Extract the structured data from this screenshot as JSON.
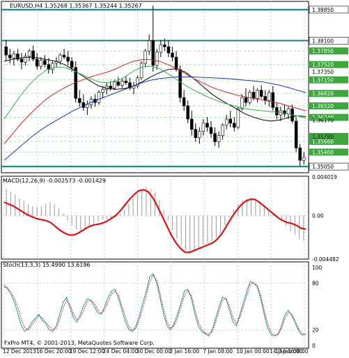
{
  "chart_data": [
    {
      "type": "candlestick",
      "panel": "price",
      "title": "EURUSD,H4  1.35268 1.35367 1.35244 1.35267",
      "y_ticks": [
        "1.38850",
        "1.38100",
        "1.37350",
        "1.36170",
        "1.35780",
        "1.35050"
      ],
      "price_level_labels": [
        "1.38850",
        "1.38100",
        "1.37850",
        "1.37520",
        "1.37150",
        "1.36820",
        "1.36520",
        "1.36240",
        "1.35780",
        "1.35660",
        "1.35400",
        "1.35050"
      ],
      "horizontal_levels": [
        1.3885,
        1.381,
        1.3505
      ],
      "ylim": [
        1.349,
        1.3905
      ],
      "current_price": "1.35050",
      "ohlc": [
        [
          1.3795,
          1.3812,
          1.376,
          1.3775
        ],
        [
          1.3775,
          1.379,
          1.3755,
          1.3768
        ],
        [
          1.3768,
          1.3785,
          1.375,
          1.3778
        ],
        [
          1.3778,
          1.379,
          1.376,
          1.3765
        ],
        [
          1.3765,
          1.378,
          1.374,
          1.3758
        ],
        [
          1.3758,
          1.378,
          1.375,
          1.3772
        ],
        [
          1.3772,
          1.379,
          1.376,
          1.3785
        ],
        [
          1.3785,
          1.3798,
          1.376,
          1.3765
        ],
        [
          1.3765,
          1.378,
          1.374,
          1.3748
        ],
        [
          1.3748,
          1.377,
          1.374,
          1.3762
        ],
        [
          1.3762,
          1.3775,
          1.3745,
          1.3752
        ],
        [
          1.3752,
          1.3768,
          1.373,
          1.374
        ],
        [
          1.374,
          1.376,
          1.373,
          1.3755
        ],
        [
          1.3755,
          1.377,
          1.3745,
          1.376
        ],
        [
          1.376,
          1.378,
          1.3752,
          1.3775
        ],
        [
          1.3775,
          1.379,
          1.3765,
          1.377
        ],
        [
          1.377,
          1.3785,
          1.375,
          1.376
        ],
        [
          1.376,
          1.377,
          1.3735,
          1.3745
        ],
        [
          1.3745,
          1.376,
          1.366,
          1.367
        ],
        [
          1.367,
          1.369,
          1.365,
          1.366
        ],
        [
          1.366,
          1.368,
          1.364,
          1.3648
        ],
        [
          1.3648,
          1.3665,
          1.363,
          1.3655
        ],
        [
          1.3655,
          1.3675,
          1.3645,
          1.3668
        ],
        [
          1.3668,
          1.368,
          1.365,
          1.366
        ],
        [
          1.366,
          1.369,
          1.3655,
          1.3685
        ],
        [
          1.3685,
          1.37,
          1.367,
          1.3692
        ],
        [
          1.3692,
          1.3708,
          1.368,
          1.37
        ],
        [
          1.37,
          1.3712,
          1.3688,
          1.3695
        ],
        [
          1.3695,
          1.3715,
          1.369,
          1.371
        ],
        [
          1.371,
          1.3722,
          1.3698,
          1.3702
        ],
        [
          1.3702,
          1.3718,
          1.3695,
          1.3712
        ],
        [
          1.3712,
          1.3725,
          1.3702,
          1.3708
        ],
        [
          1.3708,
          1.372,
          1.369,
          1.3695
        ],
        [
          1.3695,
          1.371,
          1.368,
          1.37
        ],
        [
          1.37,
          1.3725,
          1.3695,
          1.372
        ],
        [
          1.372,
          1.376,
          1.3715,
          1.3755
        ],
        [
          1.3755,
          1.379,
          1.3745,
          1.3785
        ],
        [
          1.3785,
          1.3825,
          1.3775,
          1.381
        ],
        [
          1.381,
          1.3895,
          1.3735,
          1.375
        ],
        [
          1.375,
          1.379,
          1.374,
          1.3782
        ],
        [
          1.3782,
          1.3812,
          1.377,
          1.38
        ],
        [
          1.38,
          1.3815,
          1.3785,
          1.3795
        ],
        [
          1.3795,
          1.381,
          1.377,
          1.378
        ],
        [
          1.378,
          1.3795,
          1.376,
          1.377
        ],
        [
          1.377,
          1.3785,
          1.3735,
          1.374
        ],
        [
          1.374,
          1.375,
          1.366,
          1.3672
        ],
        [
          1.3672,
          1.369,
          1.364,
          1.3652
        ],
        [
          1.3652,
          1.3665,
          1.361,
          1.362
        ],
        [
          1.362,
          1.364,
          1.358,
          1.3595
        ],
        [
          1.3595,
          1.361,
          1.3565,
          1.3575
        ],
        [
          1.3575,
          1.36,
          1.356,
          1.359
        ],
        [
          1.359,
          1.362,
          1.358,
          1.361
        ],
        [
          1.361,
          1.3625,
          1.359,
          1.36
        ],
        [
          1.36,
          1.3615,
          1.3575,
          1.3585
        ],
        [
          1.3585,
          1.36,
          1.3555,
          1.3565
        ],
        [
          1.3565,
          1.359,
          1.355,
          1.358
        ],
        [
          1.358,
          1.361,
          1.357,
          1.3605
        ],
        [
          1.3605,
          1.363,
          1.3595,
          1.362
        ],
        [
          1.362,
          1.364,
          1.36,
          1.361
        ],
        [
          1.361,
          1.3625,
          1.359,
          1.36
        ],
        [
          1.36,
          1.365,
          1.3595,
          1.3645
        ],
        [
          1.3645,
          1.368,
          1.364,
          1.3672
        ],
        [
          1.3672,
          1.3695,
          1.365,
          1.366
        ],
        [
          1.366,
          1.369,
          1.3655,
          1.3685
        ],
        [
          1.3685,
          1.37,
          1.3665,
          1.367
        ],
        [
          1.367,
          1.3695,
          1.366,
          1.369
        ],
        [
          1.369,
          1.3702,
          1.367,
          1.3675
        ],
        [
          1.3675,
          1.369,
          1.3655,
          1.3665
        ],
        [
          1.3665,
          1.369,
          1.365,
          1.3684
        ],
        [
          1.3684,
          1.37,
          1.364,
          1.3648
        ],
        [
          1.3648,
          1.366,
          1.362,
          1.363
        ],
        [
          1.363,
          1.365,
          1.3615,
          1.364
        ],
        [
          1.364,
          1.3655,
          1.3625,
          1.3632
        ],
        [
          1.3632,
          1.365,
          1.362,
          1.3645
        ],
        [
          1.3645,
          1.3655,
          1.361,
          1.3615
        ],
        [
          1.3615,
          1.3625,
          1.354,
          1.355
        ],
        [
          1.355,
          1.356,
          1.3505,
          1.352
        ],
        [
          1.352,
          1.354,
          1.351,
          1.3527
        ]
      ],
      "moving_averages": [
        {
          "color": "#000000",
          "values": [
            1.376,
            1.3765,
            1.3768,
            1.377,
            1.3768,
            1.3764,
            1.376,
            1.3752,
            1.374,
            1.3726,
            1.3712,
            1.37,
            1.3694,
            1.3692,
            1.3694,
            1.37,
            1.371,
            1.3722,
            1.3732,
            1.374,
            1.3742,
            1.3734,
            1.3718,
            1.37,
            1.3682,
            1.3668,
            1.3656,
            1.3644,
            1.3632,
            1.3624,
            1.3618,
            1.3615,
            1.3618,
            1.3624,
            1.3628,
            1.3626
          ]
        },
        {
          "color": "#2db34a",
          "values": [
            1.362,
            1.365,
            1.368,
            1.3705,
            1.3725,
            1.374,
            1.3746,
            1.3745,
            1.3738,
            1.3728,
            1.3718,
            1.371,
            1.3708,
            1.3712,
            1.3722,
            1.3736,
            1.3746,
            1.3748,
            1.3742,
            1.373,
            1.3716,
            1.3702,
            1.369,
            1.368,
            1.367,
            1.3662,
            1.3656,
            1.365,
            1.3645,
            1.3642,
            1.364,
            1.3638,
            1.3636,
            1.3632,
            1.3628,
            1.3622
          ]
        },
        {
          "color": "#d62020",
          "values": [
            1.356,
            1.3585,
            1.361,
            1.3632,
            1.3652,
            1.367,
            1.3684,
            1.3696,
            1.3706,
            1.3714,
            1.3722,
            1.3728,
            1.3734,
            1.3742,
            1.3752,
            1.376,
            1.3764,
            1.3764,
            1.376,
            1.3752,
            1.3742,
            1.373,
            1.3718,
            1.3708,
            1.3698,
            1.369,
            1.3684,
            1.3678,
            1.3674,
            1.367,
            1.3666,
            1.3662,
            1.3658,
            1.3652,
            1.3646,
            1.364
          ]
        },
        {
          "color": "#1a33c4",
          "values": [
            1.352,
            1.3538,
            1.3556,
            1.3574,
            1.359,
            1.3604,
            1.3616,
            1.3628,
            1.364,
            1.365,
            1.366,
            1.3668,
            1.3676,
            1.3684,
            1.3692,
            1.37,
            1.3708,
            1.3714,
            1.3718,
            1.372,
            1.3722,
            1.3722,
            1.3722,
            1.3721,
            1.372,
            1.3719,
            1.3718,
            1.3716,
            1.3714,
            1.3712,
            1.371,
            1.3706,
            1.3702,
            1.3696,
            1.369,
            1.3684
          ]
        }
      ],
      "x_ticks": [
        "12 Dec 2013",
        "16 Dec 20:00",
        "19 Dec 12:00",
        "24 Dec 04:00",
        "30 Dec 00:00",
        "2 Jan 16:00",
        "7 Jan 08:00",
        "10 Jan 00:00",
        "14 Jan 16:00",
        "17 Jan 08:00"
      ]
    },
    {
      "type": "histogram+line",
      "panel": "macd",
      "title": "MACD(12,26,9) -0.002573 -0.001429",
      "y_ticks": [
        "0.004019",
        "0.00",
        "-0.004482"
      ],
      "ylim": [
        -0.0045,
        0.0041
      ],
      "histogram": [
        0.0028,
        0.0025,
        0.0022,
        0.0018,
        0.0016,
        0.0012,
        0.001,
        0.0009,
        0.001,
        0.0012,
        0.0014,
        0.0012,
        0.0008,
        0.0002,
        -0.0005,
        -0.001,
        -0.0014,
        -0.0016,
        -0.0015,
        -0.0012,
        -0.0009,
        -0.0006,
        -0.0004,
        -0.0003,
        -0.0002,
        -0.0001,
        0.0002,
        0.0006,
        0.0012,
        0.0018,
        0.0023,
        0.0027,
        0.003,
        0.0028,
        0.0024,
        0.0016,
        0.0006,
        -0.0005,
        -0.0015,
        -0.0024,
        -0.0031,
        -0.0036,
        -0.0038,
        -0.0036,
        -0.0033,
        -0.003,
        -0.0028,
        -0.0026,
        -0.0023,
        -0.0018,
        -0.001,
        -0.0002,
        0.0006,
        0.0012,
        0.0016,
        0.0018,
        0.0019,
        0.0018,
        0.0015,
        0.0011,
        0.0007,
        0.0003,
        -0.0001,
        -0.0005,
        -0.001,
        -0.0016,
        -0.002,
        -0.0024,
        -0.0026
      ],
      "signal": [
        0.0014,
        0.0012,
        0.001,
        0.0007,
        0.0004,
        0.0001,
        -0.0001,
        -0.0003,
        -0.0004,
        -0.0005,
        -0.0007,
        -0.0011,
        -0.0015,
        -0.0018,
        -0.002,
        -0.002,
        -0.0018,
        -0.0015,
        -0.0012,
        -0.001,
        -0.0009,
        -0.0008,
        -0.0006,
        -0.0003,
        0.0,
        0.0005,
        0.0011,
        0.0017,
        0.0022,
        0.0026,
        0.0027,
        0.0025,
        0.0019,
        0.001,
        0.0,
        -0.001,
        -0.002,
        -0.0028,
        -0.0034,
        -0.0038,
        -0.0038,
        -0.0036,
        -0.0034,
        -0.0032,
        -0.003,
        -0.0028,
        -0.0024,
        -0.0018,
        -0.001,
        -0.0002,
        0.0005,
        0.0011,
        0.0015,
        0.0017,
        0.0017,
        0.0014,
        0.001,
        0.0006,
        0.0002,
        -0.0002,
        -0.0005,
        -0.0007,
        -0.0008,
        -0.001,
        -0.0013,
        -0.0014
      ]
    },
    {
      "type": "line",
      "panel": "stochastic",
      "title": "Stoch(13,3,3) 15.4990 13.6196",
      "y_ticks": [
        "100",
        "80",
        "20",
        "0"
      ],
      "ylim": [
        0,
        100
      ],
      "series": [
        {
          "color": "#1f9e9e",
          "values": [
            78,
            72,
            65,
            55,
            40,
            25,
            18,
            22,
            30,
            35,
            40,
            32,
            28,
            20,
            18,
            25,
            40,
            55,
            62,
            48,
            35,
            30,
            40,
            52,
            60,
            58,
            50,
            42,
            40,
            50,
            62,
            70,
            72,
            60,
            45,
            30,
            20,
            18,
            25,
            38,
            55,
            70,
            88,
            92,
            80,
            60,
            40,
            25,
            20,
            28,
            40,
            55,
            70,
            72,
            60,
            40,
            25,
            18,
            15,
            12,
            20,
            35,
            50,
            62,
            60,
            45,
            30,
            25,
            40,
            55,
            70,
            82,
            80,
            75,
            60,
            40,
            22,
            14,
            12,
            15,
            25,
            40,
            45,
            38,
            28,
            18,
            13,
            15
          ]
        },
        {
          "color": "#c81e1e",
          "values": [
            75,
            74,
            68,
            60,
            48,
            33,
            22,
            20,
            26,
            32,
            38,
            35,
            30,
            24,
            20,
            22,
            33,
            48,
            58,
            52,
            40,
            33,
            36,
            46,
            56,
            58,
            54,
            46,
            41,
            46,
            56,
            66,
            70,
            64,
            50,
            36,
            24,
            19,
            22,
            33,
            48,
            64,
            82,
            90,
            84,
            66,
            46,
            30,
            22,
            25,
            35,
            50,
            64,
            70,
            64,
            46,
            30,
            21,
            16,
            14,
            18,
            30,
            45,
            58,
            60,
            50,
            36,
            28,
            36,
            50,
            64,
            78,
            80,
            77,
            64,
            45,
            28,
            17,
            13,
            14,
            22,
            35,
            42,
            40,
            31,
            21,
            15,
            14
          ]
        }
      ],
      "levels": [
        80,
        20
      ]
    }
  ],
  "footer": "FxPro MT4, © 2001-2013, MetaQuotes Software Corp.",
  "colors": {
    "bg": "#ffffff",
    "grid": "#c8c8c8",
    "bull": "#ffffff",
    "bear": "#000000",
    "level": "#1f8a8a"
  }
}
